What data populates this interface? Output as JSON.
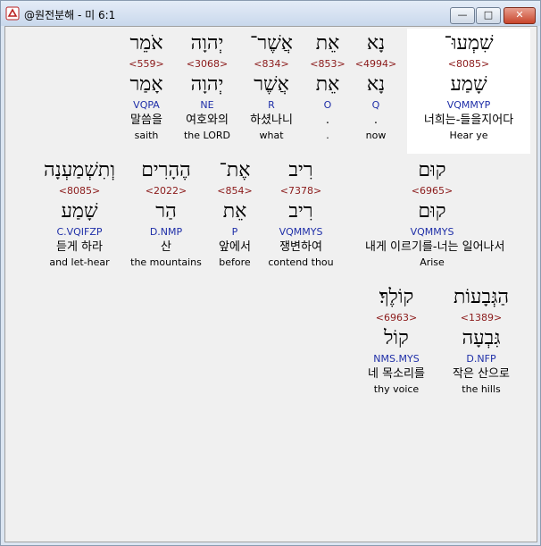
{
  "window": {
    "title": "@원전분해 - 미 6:1",
    "controls": {
      "minimize": "—",
      "maximize": "□",
      "close": "✕"
    }
  },
  "colors": {
    "strongs": "#8b1a1a",
    "parsing": "#1f2fa8",
    "highlight": "#ffffff"
  },
  "rows": [
    [
      {
        "heb": "שִׁמְעוּ־",
        "num": "<8085>",
        "lemma": "שָׁמַע",
        "parse": "VQMMYP",
        "kor": "너희는-들을지어다",
        "eng": "Hear ye"
      },
      {
        "heb": "נָא",
        "num": "<4994>",
        "lemma": "נָא",
        "parse": "Q",
        "kor": ".",
        "eng": "now"
      },
      {
        "heb": "אֵת",
        "num": "<853>",
        "lemma": "אֵת",
        "parse": "O",
        "kor": ".",
        "eng": "."
      },
      {
        "heb": "אֲשֶׁר־",
        "num": "<834>",
        "lemma": "אֲשֶׁר",
        "parse": "R",
        "kor": "하셨나니",
        "eng": "what"
      },
      {
        "heb": "יְהוָה",
        "num": "<3068>",
        "lemma": "יְהוָה",
        "parse": "NE",
        "kor": "여호와의",
        "eng": "the LORD"
      },
      {
        "heb": "אֹמֵר",
        "num": "<559>",
        "lemma": "אָמַר",
        "parse": "VQPA",
        "kor": "말씀을",
        "eng": "saith"
      }
    ],
    [
      {
        "heb": "קוּם",
        "num": "<6965>",
        "lemma": "קוּם",
        "parse": "VQMMYS",
        "kor": "내게 이르기를-너는 일어나서",
        "eng": "Arise"
      },
      {
        "heb": "רִיב",
        "num": "<7378>",
        "lemma": "רִיב",
        "parse": "VQMMYS",
        "kor": "쟁변하여",
        "eng": "contend thou"
      },
      {
        "heb": "אֶת־",
        "num": "<854>",
        "lemma": "אֵת",
        "parse": "P",
        "kor": "앞에서",
        "eng": "before"
      },
      {
        "heb": "הֶהָרִים",
        "num": "<2022>",
        "lemma": "הַר",
        "parse": "D.NMP",
        "kor": "산",
        "eng": "the mountains"
      },
      {
        "heb": "וְתִשְׁמַעְנָה",
        "num": "<8085>",
        "lemma": "שָׁמַע",
        "parse": "C.VQIFZP",
        "kor": "듣게 하라",
        "eng": "and let-hear"
      }
    ],
    [
      {
        "heb": "הַגְּבָעוֹת",
        "num": "<1389>",
        "lemma": "גִּבְעָה",
        "parse": "D.NFP",
        "kor": "작은 산으로",
        "eng": "the hills"
      },
      {
        "heb": "קוֹלֶךָ׃",
        "num": "<6963>",
        "lemma": "קוֹל",
        "parse": "NMS.MYS",
        "kor": "네 목소리를",
        "eng": "thy voice"
      }
    ]
  ]
}
